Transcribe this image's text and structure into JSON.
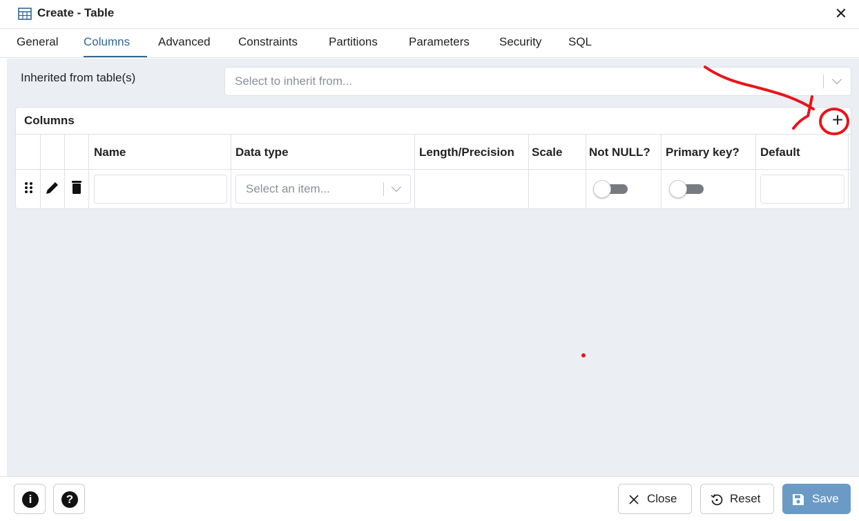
{
  "dialog": {
    "title": "Create - Table",
    "close_symbol": "✕"
  },
  "tabs": [
    {
      "label": "General"
    },
    {
      "label": "Columns"
    },
    {
      "label": "Advanced"
    },
    {
      "label": "Constraints"
    },
    {
      "label": "Partitions"
    },
    {
      "label": "Parameters"
    },
    {
      "label": "Security"
    },
    {
      "label": "SQL"
    }
  ],
  "active_tab": "Columns",
  "inherit": {
    "label": "Inherited from table(s)",
    "placeholder": "Select to inherit from..."
  },
  "columns_grid": {
    "title": "Columns",
    "add_symbol": "+",
    "headers": {
      "name": "Name",
      "data_type": "Data type",
      "length_precision": "Length/Precision",
      "scale": "Scale",
      "not_null": "Not NULL?",
      "primary_key": "Primary key?",
      "default": "Default"
    },
    "row": {
      "name_value": "",
      "data_type_placeholder": "Select an item...",
      "not_null": false,
      "primary_key": false,
      "default_value": ""
    }
  },
  "footer": {
    "info_symbol": "i",
    "help_symbol": "?",
    "close_label": "Close",
    "reset_label": "Reset",
    "save_label": "Save"
  },
  "colors": {
    "accent": "#326690",
    "panel_bg": "#ebeef3",
    "save_button": "#6b9ac6",
    "annotation": "#e8141a"
  },
  "icons": [
    "table-icon",
    "close-icon",
    "chevron-down-icon",
    "plus-icon",
    "drag-handle-icon",
    "pencil-icon",
    "trash-icon",
    "info-icon",
    "help-icon",
    "reset-icon",
    "save-icon"
  ]
}
